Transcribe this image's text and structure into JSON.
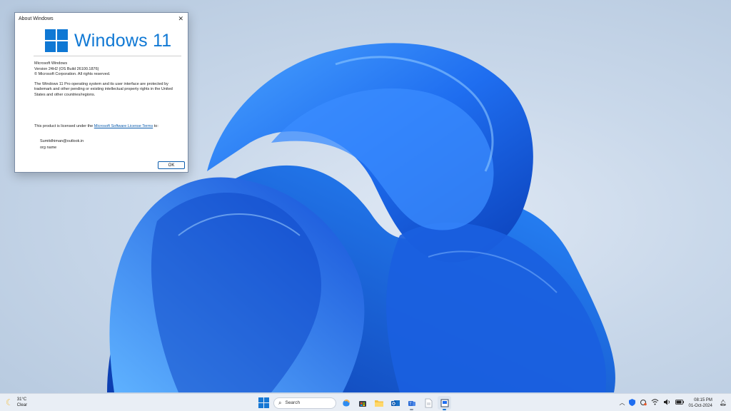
{
  "dialog": {
    "title": "About Windows",
    "close_glyph": "✕",
    "logo_text": "Windows 11",
    "product_name": "Microsoft Windows",
    "version": "Version 24H2 (OS Build 26100.1876)",
    "copyright": "© Microsoft Corporation. All rights reserved.",
    "legal_text": "The Windows 11 Pro operating system and its user interface are protected by trademark and other pending or existing intellectual property rights in the United States and other countries/regions.",
    "license_prefix": "This product is licensed under the ",
    "license_link": "Microsoft Software License Terms",
    "license_suffix": " to:",
    "licensed_user": "Sumitdhiman@outlook.in",
    "org_name": "org name",
    "ok_label": "OK"
  },
  "taskbar": {
    "weather_temp": "31°C",
    "weather_condition": "Clear",
    "search_placeholder": "Search",
    "time": "08:15 PM",
    "date": "01-Oct-2024"
  },
  "colors": {
    "accent": "#0f78d4",
    "wallpaper_bloom": "#1a5fe0"
  }
}
